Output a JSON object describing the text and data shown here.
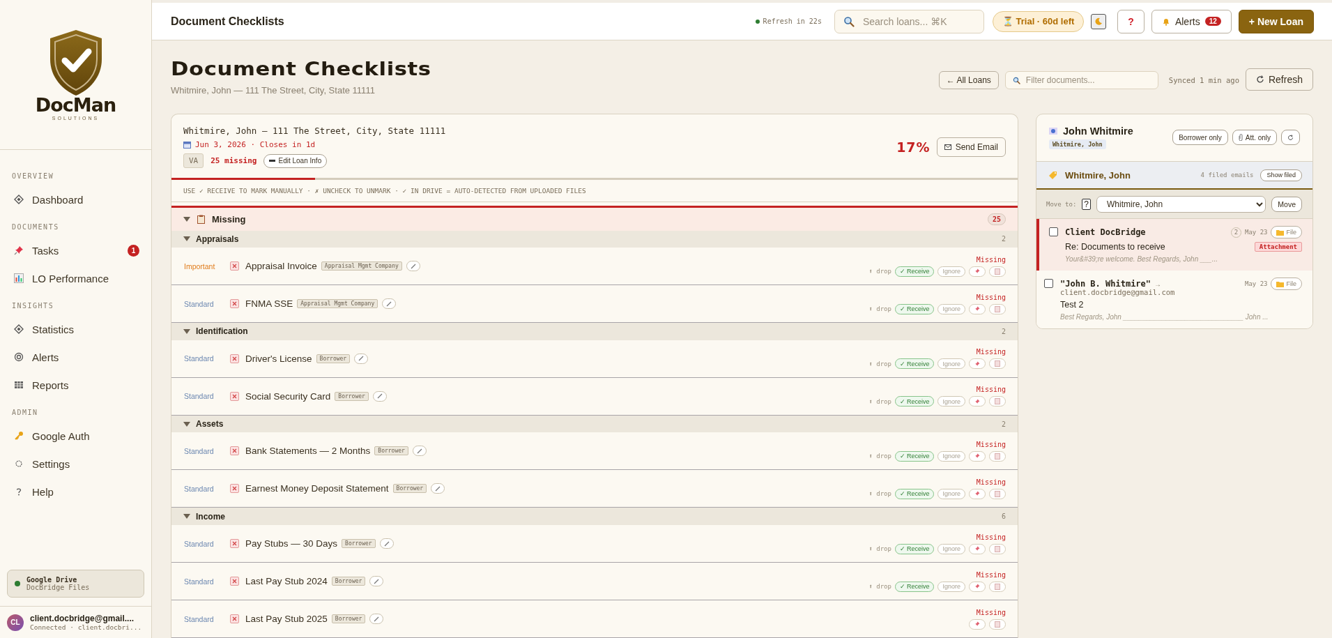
{
  "sidebar": {
    "brand": {
      "name": "DocMan",
      "tagline": "SOLUTIONS"
    },
    "sections": [
      {
        "title": "OVERVIEW",
        "items": [
          {
            "label": "Dashboard",
            "kind": "diamond"
          }
        ]
      },
      {
        "title": "DOCUMENTS",
        "items": [
          {
            "label": "Tasks",
            "kind": "pin",
            "badge": "1"
          },
          {
            "label": "LO Performance",
            "kind": "chart"
          }
        ]
      },
      {
        "title": "INSIGHTS",
        "items": [
          {
            "label": "Statistics",
            "kind": "diamond"
          },
          {
            "label": "Alerts",
            "kind": "ring"
          },
          {
            "label": "Reports",
            "kind": "grid"
          }
        ]
      },
      {
        "title": "ADMIN",
        "items": [
          {
            "label": "Google Auth",
            "kind": "key"
          },
          {
            "label": "Settings",
            "kind": "circle"
          },
          {
            "label": "Help",
            "kind": "question"
          }
        ]
      }
    ],
    "drive": {
      "title": "Google Drive",
      "subtitle": "DocBridge Files",
      "connected": true
    },
    "user": {
      "initials": "CL",
      "email": "client.docbridge@gmail....",
      "status": "Connected · client.docbri..."
    }
  },
  "topbar": {
    "title": "Document Checklists",
    "refresh": "Refresh in 22s",
    "search": {
      "placeholder": "Search loans... ⌘K"
    },
    "trial": "⏳ Trial · 60d left",
    "help": "?",
    "alerts": {
      "label": "Alerts",
      "count": "12"
    },
    "new_loan": "+ New Loan"
  },
  "header": {
    "title": "Document Checklists",
    "subtitle": "Whitmire, John — 111 The Street, City, State 11111",
    "all_loans": "← All Loans",
    "filter": {
      "placeholder": "Filter documents..."
    },
    "synced": "Synced 1 min ago",
    "refresh": "Refresh"
  },
  "loan": {
    "title": "Whitmire, John — 111 The Street, City, State 11111",
    "date": "Jun 3, 2026 · Closes in 1d",
    "type": "VA",
    "missing": "25 missing",
    "edit": "Edit Loan Info",
    "percent": "17%",
    "send_email": "Send Email",
    "level": 0.17,
    "hint": "USE ✓ RECEIVE TO MARK MANUALLY · ✗ UNCHECK TO UNMARK · ✓ IN DRIVE = AUTO-DETECTED FROM UPLOADED FILES"
  },
  "checklist": {
    "group": {
      "label": "Missing",
      "count": "25",
      "expanded": true
    },
    "sections": [
      {
        "title": "Appraisals",
        "count": "2",
        "expanded": true,
        "rows": [
          {
            "kind": "important",
            "priority": "Important",
            "name": "Appraisal Invoice",
            "tag": "Appraisal Mgmt Company",
            "status": "Missing",
            "drop": "⬆ drop",
            "receive": "✓ Receive",
            "ignore": "Ignore"
          },
          {
            "kind": "standard",
            "priority": "Standard",
            "name": "FNMA SSE",
            "tag": "Appraisal Mgmt Company",
            "status": "Missing",
            "drop": "⬆ drop",
            "receive": "✓ Receive",
            "ignore": "Ignore"
          }
        ]
      },
      {
        "title": "Identification",
        "count": "2",
        "expanded": true,
        "rows": [
          {
            "kind": "standard",
            "priority": "Standard",
            "name": "Driver's License",
            "tag": "Borrower",
            "status": "Missing",
            "drop": "⬆ drop",
            "receive": "✓ Receive",
            "ignore": "Ignore"
          },
          {
            "kind": "standard",
            "priority": "Standard",
            "name": "Social Security Card",
            "tag": "Borrower",
            "status": "Missing",
            "drop": "⬆ drop",
            "receive": "✓ Receive",
            "ignore": "Ignore"
          }
        ]
      },
      {
        "title": "Assets",
        "count": "2",
        "expanded": true,
        "rows": [
          {
            "kind": "standard",
            "priority": "Standard",
            "name": "Bank Statements — 2 Months",
            "tag": "Borrower",
            "status": "Missing",
            "drop": "⬆ drop",
            "receive": "✓ Receive",
            "ignore": "Ignore"
          },
          {
            "kind": "standard",
            "priority": "Standard",
            "name": "Earnest Money Deposit Statement",
            "tag": "Borrower",
            "status": "Missing",
            "drop": "⬆ drop",
            "receive": "✓ Receive",
            "ignore": "Ignore"
          }
        ]
      },
      {
        "title": "Income",
        "count": "6",
        "expanded": true,
        "rows": [
          {
            "kind": "standard",
            "priority": "Standard",
            "name": "Pay Stubs — 30 Days",
            "tag": "Borrower",
            "status": "Missing",
            "drop": "⬆ drop",
            "receive": "✓ Receive",
            "ignore": "Ignore"
          },
          {
            "kind": "standard",
            "priority": "Standard",
            "name": "Last Pay Stub 2024",
            "tag": "Borrower",
            "status": "Missing",
            "drop": "⬆ drop",
            "receive": "✓ Receive",
            "ignore": "Ignore"
          },
          {
            "kind": "standard",
            "priority": "Standard",
            "name": "Last Pay Stub 2025",
            "tag": "Borrower",
            "status": "Missing"
          }
        ]
      }
    ]
  },
  "inbox": {
    "name": "John Whitmire",
    "tag": "Whitmire, John",
    "borrower_only": "Borrower only",
    "att_only": "Att. only",
    "folder": {
      "name": "Whitmire, John",
      "count": "4 filed emails",
      "show": "Show filed"
    },
    "move": {
      "label": "Move to:",
      "help": "?",
      "value": "Whitmire, John",
      "button": "Move"
    },
    "emails": [
      {
        "selected": true,
        "checked": false,
        "from": "Client DocBridge",
        "count": "2",
        "date": "May 23",
        "file": "File",
        "subject": "Re: Documents to receive",
        "attachment": "Attachment",
        "preview": "Your&#39;re welcome. Best Regards, John ___..."
      },
      {
        "selected": false,
        "checked": false,
        "from": "\"John B. Whitmire\"",
        "arrow": "→",
        "address": "client.docbridge@gmail.com",
        "date": "May 23",
        "file": "File",
        "subject": "Test 2",
        "preview": "Best Regards, John _______________________________ John ..."
      }
    ]
  }
}
